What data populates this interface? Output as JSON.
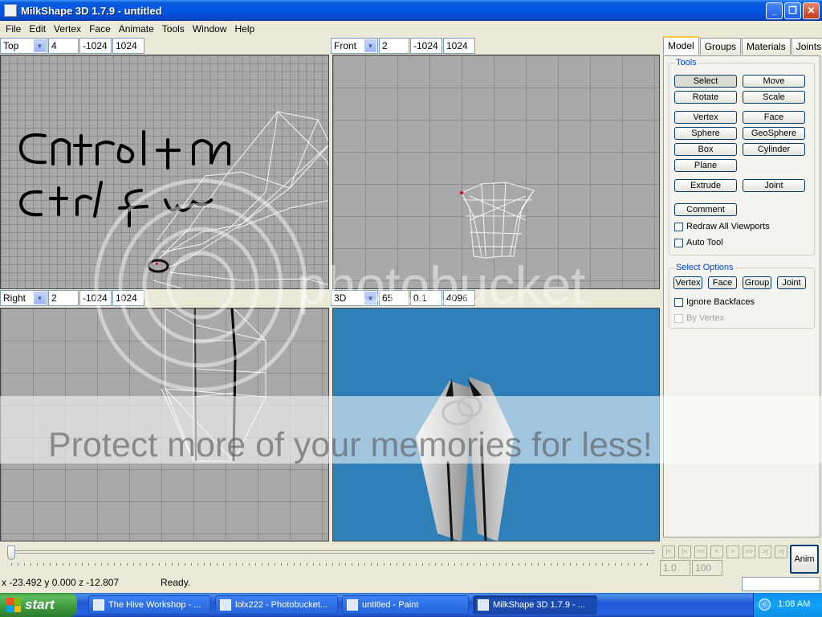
{
  "window": {
    "title": "MilkShape 3D 1.7.9 - untitled",
    "buttons": [
      "_",
      "❐",
      "✕"
    ]
  },
  "menu": [
    "File",
    "Edit",
    "Vertex",
    "Face",
    "Animate",
    "Tools",
    "Window",
    "Help"
  ],
  "viewports": {
    "top": {
      "view": "Top",
      "zoom": "4",
      "min": "-1024",
      "max": "1024"
    },
    "front": {
      "view": "Front",
      "zoom": "2",
      "min": "-1024",
      "max": "1024"
    },
    "right": {
      "view": "Right",
      "zoom": "2",
      "min": "-1024",
      "max": "1024"
    },
    "3d": {
      "view": "3D",
      "fov": "65",
      "near": "0.1",
      "far": "4096"
    }
  },
  "tabs": [
    "Model",
    "Groups",
    "Materials",
    "Joints"
  ],
  "tools": {
    "title": "Tools",
    "buttons": [
      "Select",
      "Move",
      "Rotate",
      "Scale",
      "Vertex",
      "Face",
      "Sphere",
      "GeoSphere",
      "Box",
      "Cylinder",
      "Plane",
      "Extrude",
      "Joint",
      "Comment"
    ],
    "redraw_all": "Redraw All Viewports",
    "auto_tool": "Auto Tool"
  },
  "select_options": {
    "title": "Select Options",
    "buttons": [
      "Vertex",
      "Face",
      "Group",
      "Joint"
    ],
    "ignore_backfaces": "Ignore Backfaces",
    "by_vertex": "By Vertex"
  },
  "animation": {
    "frame": "1.0",
    "total": "100",
    "anim_label": "Anim",
    "nav": [
      "|<",
      "|<",
      "<<",
      "<",
      ">",
      ">>",
      ">|",
      ">|"
    ]
  },
  "status": {
    "coords": "x -23.492 y 0.000 z -12.807",
    "message": "Ready."
  },
  "taskbar": {
    "start": "start",
    "tasks": [
      "The Hive Workshop - ...",
      "lolx222 - Photobucket...",
      "untitled - Paint",
      "MilkShape 3D 1.7.9 - ..."
    ],
    "clock": "1:08 AM"
  },
  "watermark": {
    "brand": "photobucket",
    "slogan": "Protect more of your memories for less!"
  },
  "drawing": {
    "line1": "Cntrol+n",
    "line2": "ctrl+w"
  },
  "colors": {
    "title_blue": "#0054e3",
    "sky": "#2f7fb8",
    "grid": "#a9a9a9"
  }
}
